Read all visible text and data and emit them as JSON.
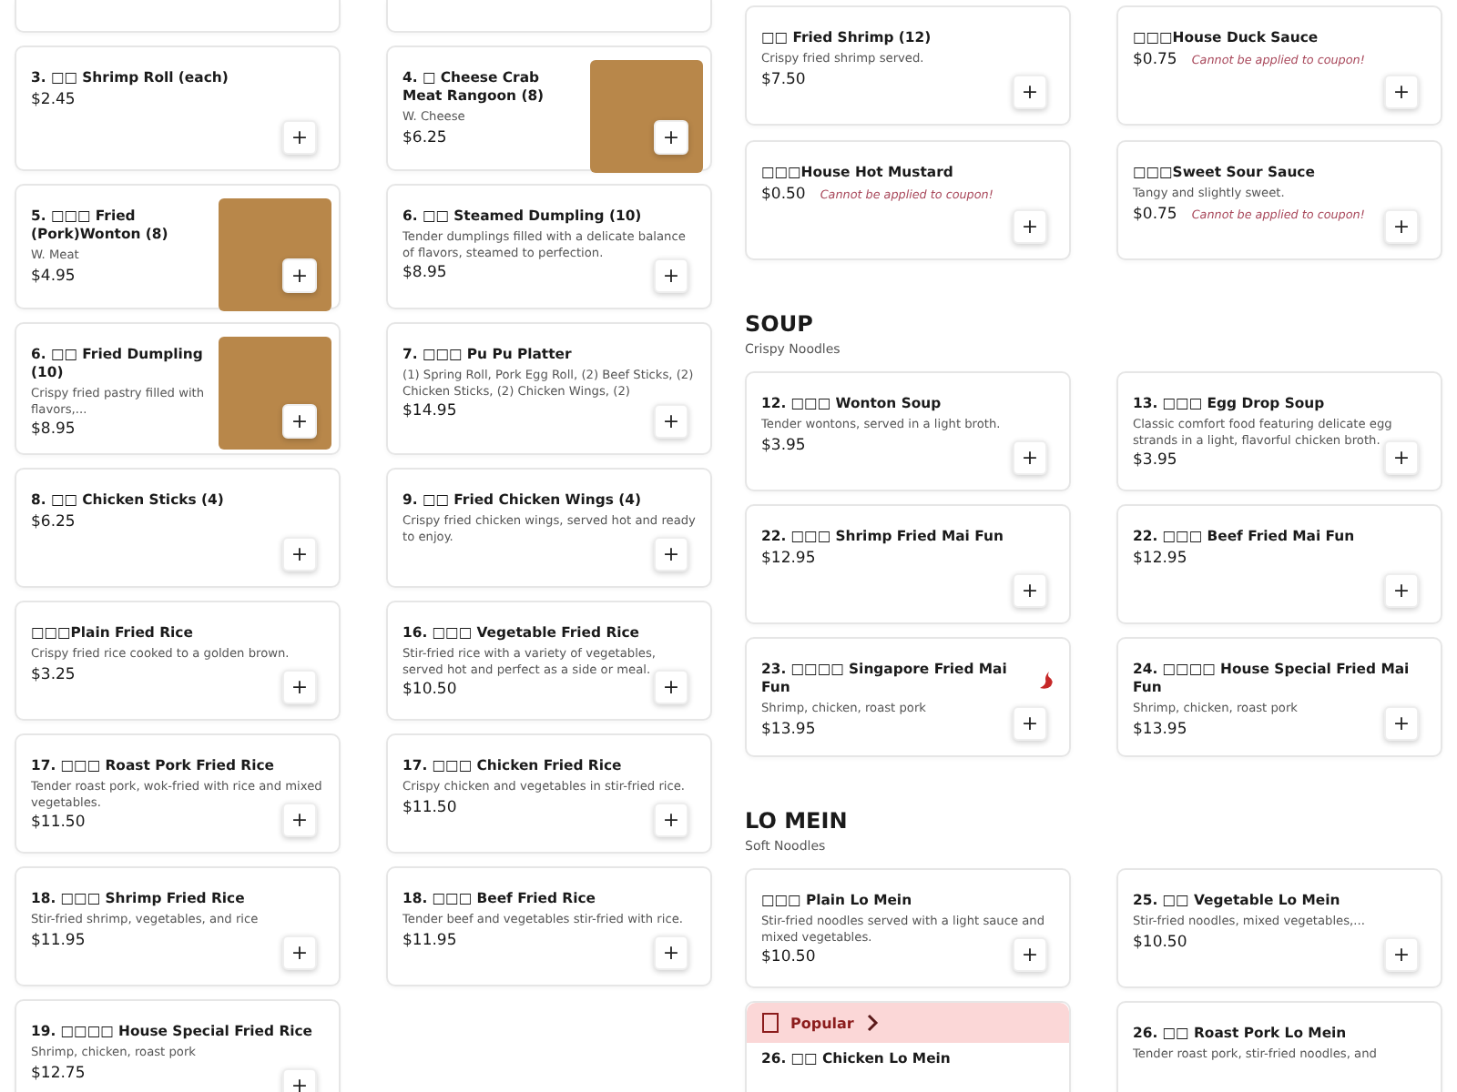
{
  "left_panel": {
    "items": [
      {
        "kind": "cut_off"
      },
      {
        "kind": "cut_off"
      },
      {
        "kind": "item",
        "name": "3. □□ Shrimp Roll (each)",
        "price": "$2.45",
        "add": "+"
      },
      {
        "kind": "item",
        "name": "4. □ Cheese Crab Meat Rangoon (8)",
        "description": "W. Cheese",
        "price": "$6.25",
        "photo": true,
        "add": "+"
      },
      {
        "kind": "item",
        "name": "5. □□□ Fried (Pork)Wonton (8)",
        "description": "W. Meat",
        "price": "$4.95",
        "photo": true,
        "add": "+"
      },
      {
        "kind": "item",
        "name": "6. □□ Steamed Dumpling (10)",
        "description": "Tender dumplings filled with a delicate balance of flavors, steamed to perfection.",
        "price": "$8.95",
        "add": "+"
      },
      {
        "kind": "item",
        "name": "6. □□ Fried Dumpling (10)",
        "description": "Crispy fried pastry filled with flavors,...",
        "price": "$8.95",
        "photo": true,
        "add": "+"
      },
      {
        "kind": "item",
        "name": "7. □□□ Pu Pu Platter",
        "description": "(1) Spring Roll, Pork Egg Roll, (2) Beef Sticks, (2) Chicken Sticks, (2) Chicken Wings, (2)",
        "price": "$14.95",
        "add": "+"
      },
      {
        "kind": "item",
        "name": "8. □□ Chicken Sticks (4)",
        "price": "$6.25",
        "add": "+"
      },
      {
        "kind": "item",
        "name": "9. □□ Fried Chicken Wings (4)",
        "description": "Crispy fried chicken wings, served hot and ready to enjoy.",
        "add": "+"
      },
      {
        "kind": "item",
        "name": "□□□Plain Fried Rice",
        "description": "Crispy fried rice cooked to a golden brown.",
        "price": "$3.25",
        "add": "+"
      },
      {
        "kind": "item",
        "name": "16. □□□ Vegetable Fried Rice",
        "description": "Stir-fried rice with a variety of vegetables, served hot and perfect as a side or meal.",
        "price": "$10.50",
        "add": "+"
      },
      {
        "kind": "item",
        "name": "17. □□□ Roast Pork Fried Rice",
        "description": "Tender roast pork, wok-fried with rice and mixed vegetables.",
        "price": "$11.50",
        "add": "+"
      },
      {
        "kind": "item",
        "name": "17. □□□ Chicken Fried Rice",
        "description": "Crispy chicken and vegetables in stir-fried rice.",
        "price": "$11.50",
        "add": "+"
      },
      {
        "kind": "item",
        "name": "18. □□□ Shrimp Fried Rice",
        "description": "Stir-fried shrimp, vegetables, and rice",
        "price": "$11.95",
        "add": "+"
      },
      {
        "kind": "item",
        "name": "18. □□□ Beef Fried Rice",
        "description": "Tender beef and vegetables stir-fried with rice.",
        "price": "$11.95",
        "add": "+"
      },
      {
        "kind": "item",
        "name": "19. □□□□ House Special Fried Rice",
        "description": "Shrimp, chicken, roast pork",
        "price": "$12.75",
        "add": "+"
      }
    ]
  },
  "right_panel": {
    "sections": [
      {
        "items": [
          {
            "kind": "item",
            "name": "□□ Fried Shrimp (12)",
            "description": "Crispy fried shrimp served.",
            "price": "$7.50",
            "add": "+"
          },
          {
            "kind": "item",
            "name": "□□□House Duck Sauce",
            "price": "$0.75",
            "note": "Cannot be applied to coupon!",
            "add": "+"
          },
          {
            "kind": "item",
            "name": "□□□House Hot Mustard",
            "price": "$0.50",
            "note": "Cannot be applied to coupon!",
            "add": "+"
          },
          {
            "kind": "item",
            "name": "□□□Sweet Sour Sauce",
            "description": "Tangy and slightly sweet.",
            "price": "$0.75",
            "note": "Cannot be applied to coupon!",
            "add": "+"
          }
        ]
      },
      {
        "heading": "SOUP",
        "subheading": "Crispy Noodles",
        "items": [
          {
            "kind": "item",
            "name": "12. □□□ Wonton Soup",
            "description": "Tender wontons, served in a light broth.",
            "price": "$3.95",
            "add": "+"
          },
          {
            "kind": "item",
            "name": "13. □□□ Egg Drop Soup",
            "description": "Classic comfort food featuring delicate egg strands in a light, flavorful chicken broth.",
            "price": "$3.95",
            "add": "+"
          },
          {
            "kind": "item",
            "name": "22. □□□ Shrimp Fried Mai Fun",
            "price": "$12.95",
            "add": "+"
          },
          {
            "kind": "item",
            "name": "22. □□□ Beef Fried Mai Fun",
            "price": "$12.95",
            "add": "+"
          },
          {
            "kind": "item",
            "name": "23. □□□□ Singapore Fried Mai Fun",
            "description": "Shrimp, chicken, roast pork",
            "price": "$13.95",
            "spicy": true,
            "add": "+"
          },
          {
            "kind": "item",
            "name": "24. □□□□ House Special Fried Mai Fun",
            "description": "Shrimp, chicken, roast pork",
            "price": "$13.95",
            "add": "+"
          }
        ]
      },
      {
        "heading": "LO MEIN",
        "subheading": "Soft Noodles",
        "items": [
          {
            "kind": "item",
            "name": "□□□ Plain Lo Mein",
            "description": "Stir-fried noodles served with a light sauce and mixed vegetables.",
            "price": "$10.50",
            "add": "+"
          },
          {
            "kind": "item",
            "name": "25. □□ Vegetable Lo Mein",
            "description": "Stir-fried noodles, mixed vegetables,...",
            "price": "$10.50",
            "add": "+"
          },
          {
            "kind": "item",
            "name": "26. □□ Chicken Lo Mein",
            "popular": "Popular"
          },
          {
            "kind": "item",
            "name": "26. □□ Roast Pork Lo Mein",
            "description": "Tender roast pork, stir-fried noodles, and"
          }
        ]
      }
    ]
  }
}
